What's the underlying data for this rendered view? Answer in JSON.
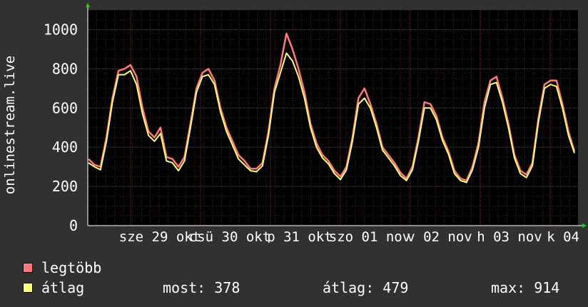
{
  "chart_data": {
    "type": "area",
    "title": "",
    "ylabel": "onlinestream.live",
    "ylim": [
      0,
      1100
    ],
    "yticks": [
      0,
      200,
      400,
      600,
      800,
      1000
    ],
    "x_tick_labels": [
      "sze 29 okt",
      "csü 30 okt",
      "p 31 okt",
      "szo 01 nov",
      "v 02 nov",
      "h 03 nov",
      "k 04 nov"
    ],
    "x_tick_labels_rendered": [
      "sze 29 okt",
      "csü 30 okt",
      "p 31 okt",
      "szo 01 nov",
      "v 02 nov",
      "h 03 nov",
      "k 04 nov"
    ],
    "grid": true,
    "series": [
      {
        "name": "legtöbb",
        "color": "#ff7b7b",
        "values": [
          340,
          310,
          300,
          450,
          650,
          790,
          800,
          820,
          760,
          600,
          480,
          450,
          500,
          350,
          340,
          300,
          350,
          520,
          700,
          780,
          800,
          740,
          600,
          500,
          430,
          360,
          330,
          290,
          290,
          320,
          480,
          700,
          820,
          980,
          900,
          800,
          680,
          520,
          420,
          360,
          330,
          280,
          250,
          300,
          450,
          650,
          700,
          620,
          520,
          400,
          360,
          320,
          270,
          240,
          300,
          450,
          630,
          620,
          560,
          450,
          380,
          280,
          240,
          230,
          300,
          420,
          630,
          740,
          760,
          650,
          520,
          360,
          280,
          260,
          320,
          550,
          720,
          740,
          740,
          620,
          480,
          380
        ]
      },
      {
        "name": "átlag",
        "color": "#ffff7b",
        "values": [
          320,
          300,
          285,
          430,
          630,
          770,
          770,
          790,
          720,
          570,
          460,
          430,
          470,
          330,
          320,
          280,
          330,
          500,
          680,
          760,
          770,
          720,
          580,
          480,
          410,
          340,
          310,
          280,
          275,
          305,
          460,
          680,
          780,
          880,
          840,
          760,
          650,
          500,
          400,
          345,
          315,
          265,
          235,
          285,
          430,
          620,
          650,
          600,
          500,
          385,
          345,
          305,
          255,
          230,
          285,
          430,
          600,
          600,
          540,
          435,
          365,
          265,
          230,
          220,
          285,
          400,
          600,
          720,
          730,
          630,
          500,
          345,
          265,
          245,
          305,
          530,
          700,
          720,
          710,
          600,
          460,
          370
        ]
      }
    ],
    "legend": {
      "position": "bottom-left",
      "items": [
        {
          "label": "legtöbb",
          "color": "#ff7b7b"
        },
        {
          "label": "átlag",
          "color": "#ffff7b"
        }
      ]
    },
    "stats": {
      "most": "most: 378",
      "atlag": "átlag: 479",
      "max": "max: 914"
    }
  }
}
